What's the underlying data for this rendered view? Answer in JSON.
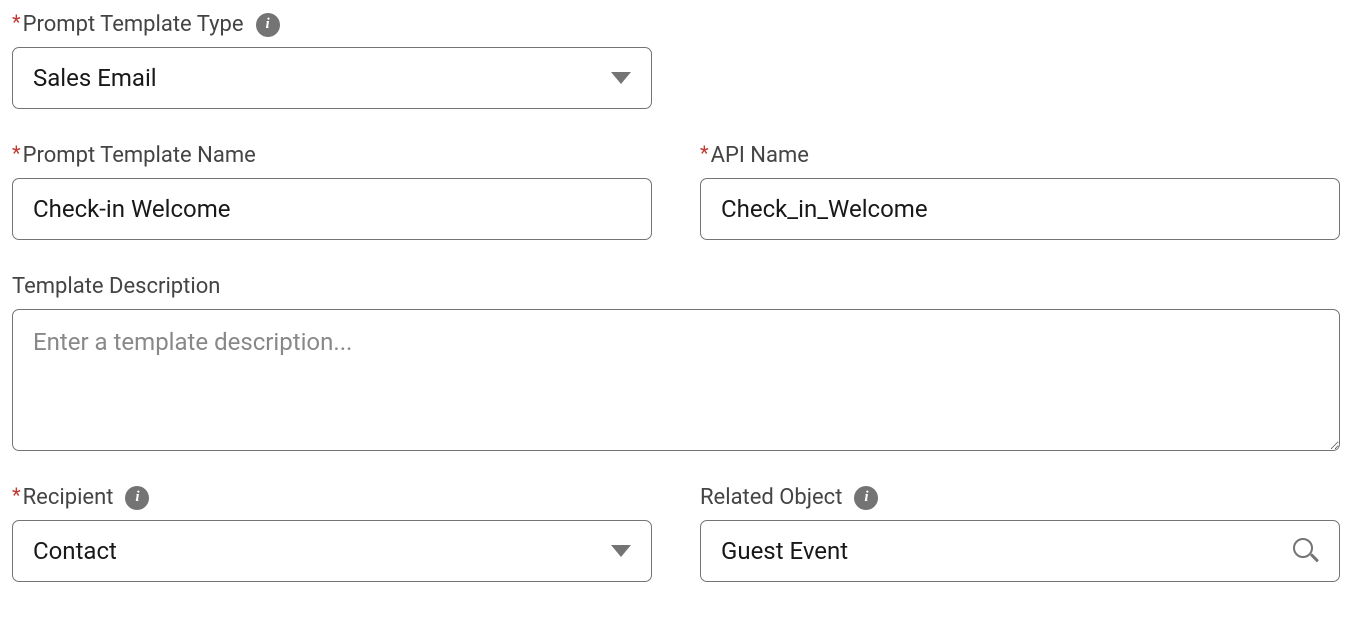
{
  "fields": {
    "template_type": {
      "label": "Prompt Template Type",
      "value": "Sales Email"
    },
    "template_name": {
      "label": "Prompt Template Name",
      "value": "Check-in Welcome"
    },
    "api_name": {
      "label": "API Name",
      "value": "Check_in_Welcome"
    },
    "description": {
      "label": "Template Description",
      "placeholder": "Enter a template description...",
      "value": ""
    },
    "recipient": {
      "label": "Recipient",
      "value": "Contact"
    },
    "related_object": {
      "label": "Related Object",
      "value": "Guest Event"
    }
  }
}
